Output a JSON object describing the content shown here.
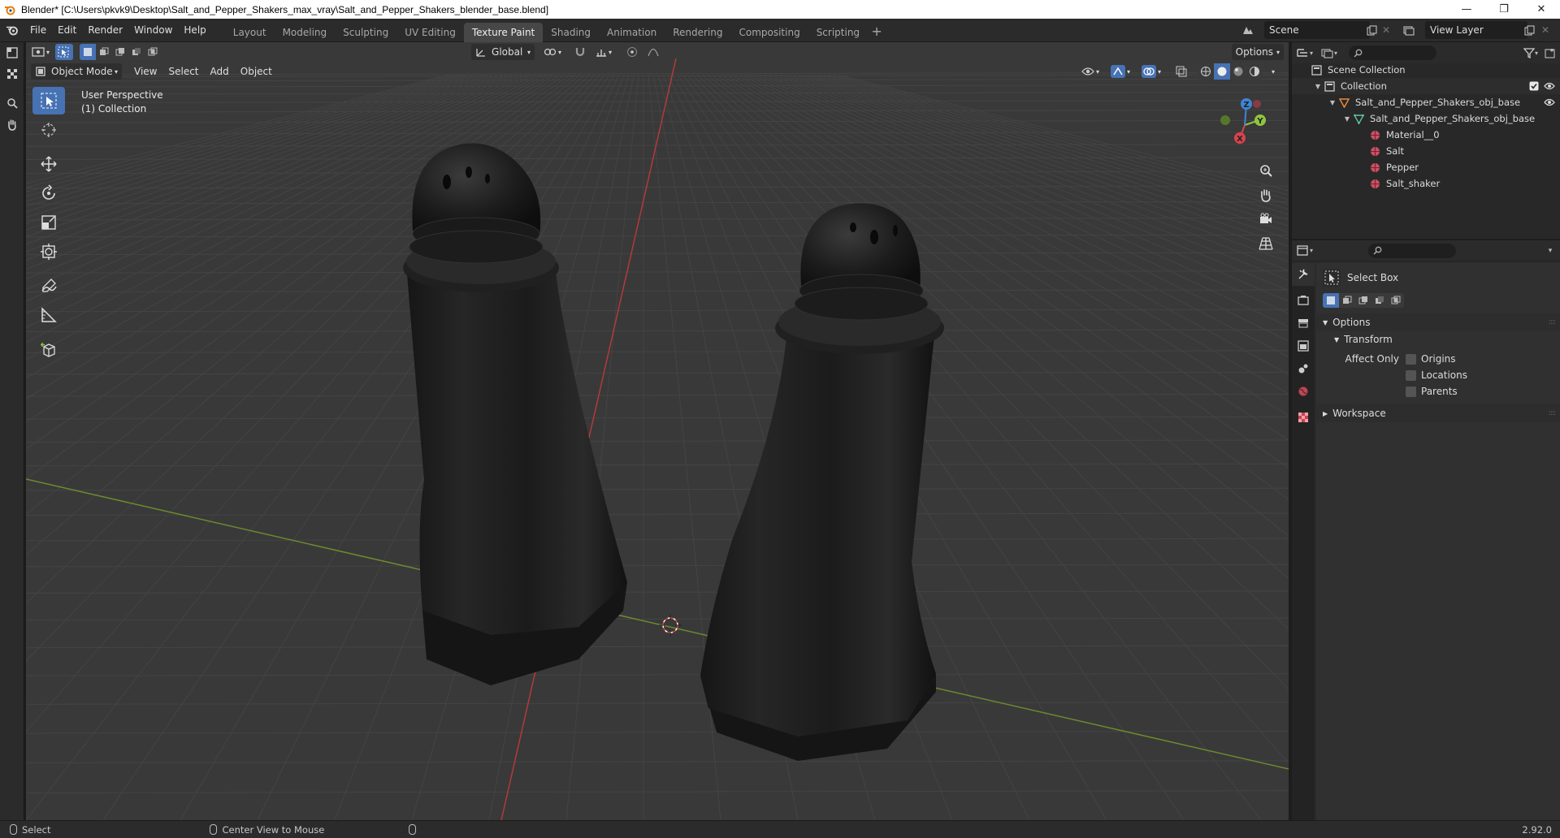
{
  "window": {
    "title": "Blender* [C:\\Users\\pkvk9\\Desktop\\Salt_and_Pepper_Shakers_max_vray\\Salt_and_Pepper_Shakers_blender_base.blend]",
    "minimize": "—",
    "maximize": "❐",
    "close": "✕"
  },
  "menu": [
    "File",
    "Edit",
    "Render",
    "Window",
    "Help"
  ],
  "workspaces": [
    {
      "label": "Layout",
      "active": false
    },
    {
      "label": "Modeling",
      "active": false
    },
    {
      "label": "Sculpting",
      "active": false
    },
    {
      "label": "UV Editing",
      "active": false
    },
    {
      "label": "Texture Paint",
      "active": true
    },
    {
      "label": "Shading",
      "active": false
    },
    {
      "label": "Animation",
      "active": false
    },
    {
      "label": "Rendering",
      "active": false
    },
    {
      "label": "Compositing",
      "active": false
    },
    {
      "label": "Scripting",
      "active": false
    }
  ],
  "scene": {
    "name": "Scene",
    "view_layer": "View Layer"
  },
  "viewport": {
    "mode": "Object Mode",
    "menus": [
      "View",
      "Select",
      "Add",
      "Object"
    ],
    "orientation": "Global",
    "options_label": "Options",
    "overlay_line1": "User Perspective",
    "overlay_line2": "(1) Collection",
    "axis": {
      "x": "X",
      "y": "Y",
      "z": "Z"
    },
    "colors": {
      "x_axis": "#d9434e",
      "y_axis": "#8cc63f",
      "z_axis": "#3d86d9",
      "active": "#4772b3"
    }
  },
  "outliner": {
    "root": "Scene Collection",
    "rows": [
      {
        "label": "Collection",
        "icon": "collection-icon"
      },
      {
        "label": "Salt_and_Pepper_Shakers_obj_base",
        "icon": "object-icon"
      },
      {
        "label": "Salt_and_Pepper_Shakers_obj_base",
        "icon": "mesh-icon"
      },
      {
        "label": "Material__0",
        "icon": "material-icon"
      },
      {
        "label": "Salt",
        "icon": "material-icon"
      },
      {
        "label": "Pepper",
        "icon": "material-icon"
      },
      {
        "label": "Salt_shaker",
        "icon": "material-icon"
      }
    ]
  },
  "properties": {
    "tool_name": "Select Box",
    "options_panel": "Options",
    "transform_panel": "Transform",
    "affect_only": "Affect Only",
    "checkboxes": [
      "Origins",
      "Locations",
      "Parents"
    ],
    "workspace_panel": "Workspace"
  },
  "status": {
    "select": "Select",
    "center_view": "Center View to Mouse",
    "version": "2.92.0"
  }
}
